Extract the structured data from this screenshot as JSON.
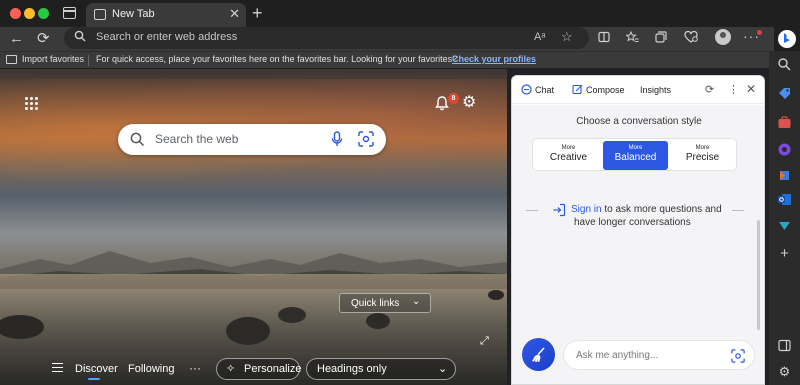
{
  "tab": {
    "title": "New Tab",
    "close": "✕",
    "new_tab": "+"
  },
  "toolbar": {
    "back": "←",
    "reload": "⟳",
    "omnibox_placeholder": "Search or enter web address",
    "read_aloud": "Aᵃ",
    "favorite_star": "☆",
    "more": "···"
  },
  "favorites_bar": {
    "import_label": "Import favorites",
    "message": "For quick access, place your favorites here on the favorites bar. Looking for your favorites?",
    "link": "Check your profiles"
  },
  "newtab": {
    "notification_count": "8",
    "search_placeholder": "Search the web",
    "quick_links_label": "Quick links",
    "bottom": {
      "discover": "Discover",
      "following": "Following",
      "more": "···",
      "personalize": "Personalize",
      "headings": "Headings only"
    }
  },
  "copilot": {
    "tabs": {
      "chat": "Chat",
      "compose": "Compose",
      "insights": "Insights"
    },
    "conversation_title": "Choose a conversation style",
    "styles": [
      {
        "small": "More",
        "big": "Creative"
      },
      {
        "small": "More",
        "big": "Balanced"
      },
      {
        "small": "More",
        "big": "Precise"
      }
    ],
    "signin_link": "Sign in",
    "signin_rest": "to ask more questions and",
    "signin_line2": "have longer conversations",
    "ask_placeholder": "Ask me anything..."
  },
  "colors": {
    "accent": "#2b57e3",
    "link": "#8ab4f8",
    "badge": "#e2452f"
  },
  "icons": [
    "apps-grid-icon",
    "bell-icon",
    "gear-icon",
    "search-icon",
    "mic-icon",
    "visual-search-icon",
    "expand-icon",
    "broom-icon",
    "sign-in-icon",
    "bing-icon"
  ]
}
